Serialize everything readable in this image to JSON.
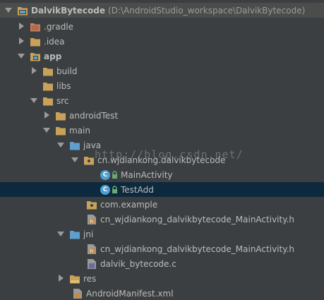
{
  "project": {
    "name": "DalvikBytecode",
    "path": "(D:\\AndroidStudio_workspace\\DalvikBytecode)"
  },
  "items": {
    "gradle": ".gradle",
    "idea": ".idea",
    "app": "app",
    "build": "build",
    "libs": "libs",
    "src": "src",
    "androidTest": "androidTest",
    "main": "main",
    "java": "java",
    "package": "cn.wjdiankong.dalvikbytecode",
    "main_activity": "MainActivity",
    "test_add": "TestAdd",
    "com_example": "com.example",
    "header1": "cn_wjdiankong_dalvikbytecode_MainActivity.h",
    "jni": "jni",
    "header2": "cn_wjdiankong_dalvikbytecode_MainActivity.h",
    "c_file": "dalvik_bytecode.c",
    "res": "res",
    "manifest": "AndroidManifest.xml"
  },
  "watermark": "http://blog.csdn.net/",
  "colors": {
    "background": "#3c3f41",
    "selected": "#0d293e",
    "folder": "#c9a25a",
    "source_folder": "#5f9fcf",
    "class_icon": "#4d9fd1",
    "excluded_folder": "#d27b57"
  }
}
